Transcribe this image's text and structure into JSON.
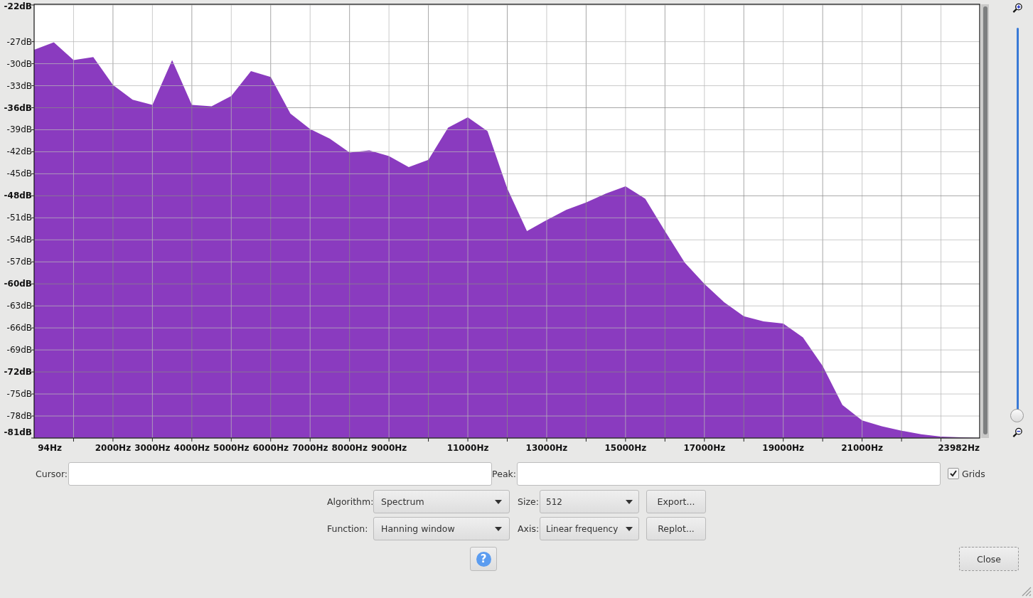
{
  "chart": {
    "chart_data": {
      "type": "area",
      "xlabel": null,
      "ylabel": null,
      "x": [
        0,
        500,
        1000,
        1500,
        2000,
        2500,
        3000,
        3500,
        4000,
        4500,
        5000,
        5500,
        6000,
        6500,
        7000,
        7500,
        8000,
        8500,
        9000,
        9500,
        10000,
        10500,
        11000,
        11500,
        12000,
        12500,
        13000,
        13500,
        14000,
        14500,
        15000,
        15500,
        16000,
        16500,
        17000,
        17500,
        18000,
        18500,
        19000,
        19500,
        20000,
        20500,
        21000,
        21500,
        22000,
        22500,
        23000,
        23500,
        23982
      ],
      "grid": true,
      "series": [
        {
          "color": "#8a3bbf",
          "values": [
            -28.1,
            -27.1,
            -29.5,
            -29.1,
            -32.9,
            -34.9,
            -35.6,
            -29.5,
            -35.6,
            -35.8,
            -34.4,
            -31.0,
            -31.8,
            -36.8,
            -38.9,
            -40.2,
            -42.1,
            -41.8,
            -42.6,
            -44.1,
            -43.1,
            -38.7,
            -37.3,
            -39.2,
            -47.0,
            -52.8,
            -51.3,
            -49.9,
            -48.9,
            -47.7,
            -46.7,
            -48.4,
            -52.8,
            -57.1,
            -60.0,
            -62.5,
            -64.4,
            -65.1,
            -65.4,
            -67.3,
            -71.2,
            -76.5,
            -78.6,
            -79.4,
            -80.0,
            -80.5,
            -80.8,
            -80.9,
            -81.0
          ]
        }
      ],
      "xlim": [
        0,
        23982
      ],
      "ylim": [
        -81,
        -22
      ],
      "xticks": [
        {
          "value": 94,
          "label": "94Hz"
        },
        {
          "value": 2000,
          "label": "2000Hz"
        },
        {
          "value": 3000,
          "label": "3000Hz"
        },
        {
          "value": 4000,
          "label": "4000Hz"
        },
        {
          "value": 5000,
          "label": "5000Hz"
        },
        {
          "value": 6000,
          "label": "6000Hz"
        },
        {
          "value": 7000,
          "label": "7000Hz"
        },
        {
          "value": 8000,
          "label": "8000Hz"
        },
        {
          "value": 9000,
          "label": "9000Hz"
        },
        {
          "value": 11000,
          "label": "11000Hz"
        },
        {
          "value": 13000,
          "label": "13000Hz"
        },
        {
          "value": 15000,
          "label": "15000Hz"
        },
        {
          "value": 17000,
          "label": "17000Hz"
        },
        {
          "value": 19000,
          "label": "19000Hz"
        },
        {
          "value": 21000,
          "label": "21000Hz"
        },
        {
          "value": 23982,
          "label": "23982Hz"
        }
      ],
      "yticks": [
        {
          "value": -22,
          "label": "-22dB"
        },
        {
          "value": -27,
          "label": "-27dB"
        },
        {
          "value": -30,
          "label": "-30dB"
        },
        {
          "value": -33,
          "label": "-33dB"
        },
        {
          "value": -36,
          "label": "-36dB"
        },
        {
          "value": -39,
          "label": "-39dB"
        },
        {
          "value": -42,
          "label": "-42dB"
        },
        {
          "value": -45,
          "label": "-45dB"
        },
        {
          "value": -48,
          "label": "-48dB"
        },
        {
          "value": -51,
          "label": "-51dB"
        },
        {
          "value": -54,
          "label": "-54dB"
        },
        {
          "value": -57,
          "label": "-57dB"
        },
        {
          "value": -60,
          "label": "-60dB"
        },
        {
          "value": -63,
          "label": "-63dB"
        },
        {
          "value": -66,
          "label": "-66dB"
        },
        {
          "value": -69,
          "label": "-69dB"
        },
        {
          "value": -72,
          "label": "-72dB"
        },
        {
          "value": -75,
          "label": "-75dB"
        },
        {
          "value": -78,
          "label": "-78dB"
        },
        {
          "value": -81,
          "label": "-81dB"
        }
      ]
    }
  },
  "zoom_slider": {
    "level": 0
  },
  "cursor": {
    "label": "Cursor:"
  },
  "peak": {
    "label": "Peak:"
  },
  "grids": {
    "label": "Grids",
    "checked": true
  },
  "controls": [
    [
      {
        "kind": "dropdown",
        "label": "Algorithm:",
        "value": "Spectrum"
      },
      {
        "kind": "dropdown",
        "label": "Size:",
        "value": "512"
      },
      {
        "kind": "button",
        "label": "Export..."
      }
    ],
    [
      {
        "kind": "dropdown",
        "label": "Function:",
        "value": "Hanning window"
      },
      {
        "kind": "dropdown",
        "label": "Axis:",
        "value": "Linear frequency"
      },
      {
        "kind": "button",
        "label": "Replot..."
      }
    ]
  ],
  "help_button": {
    "label": "?"
  },
  "close_button": {
    "label": "Close"
  }
}
